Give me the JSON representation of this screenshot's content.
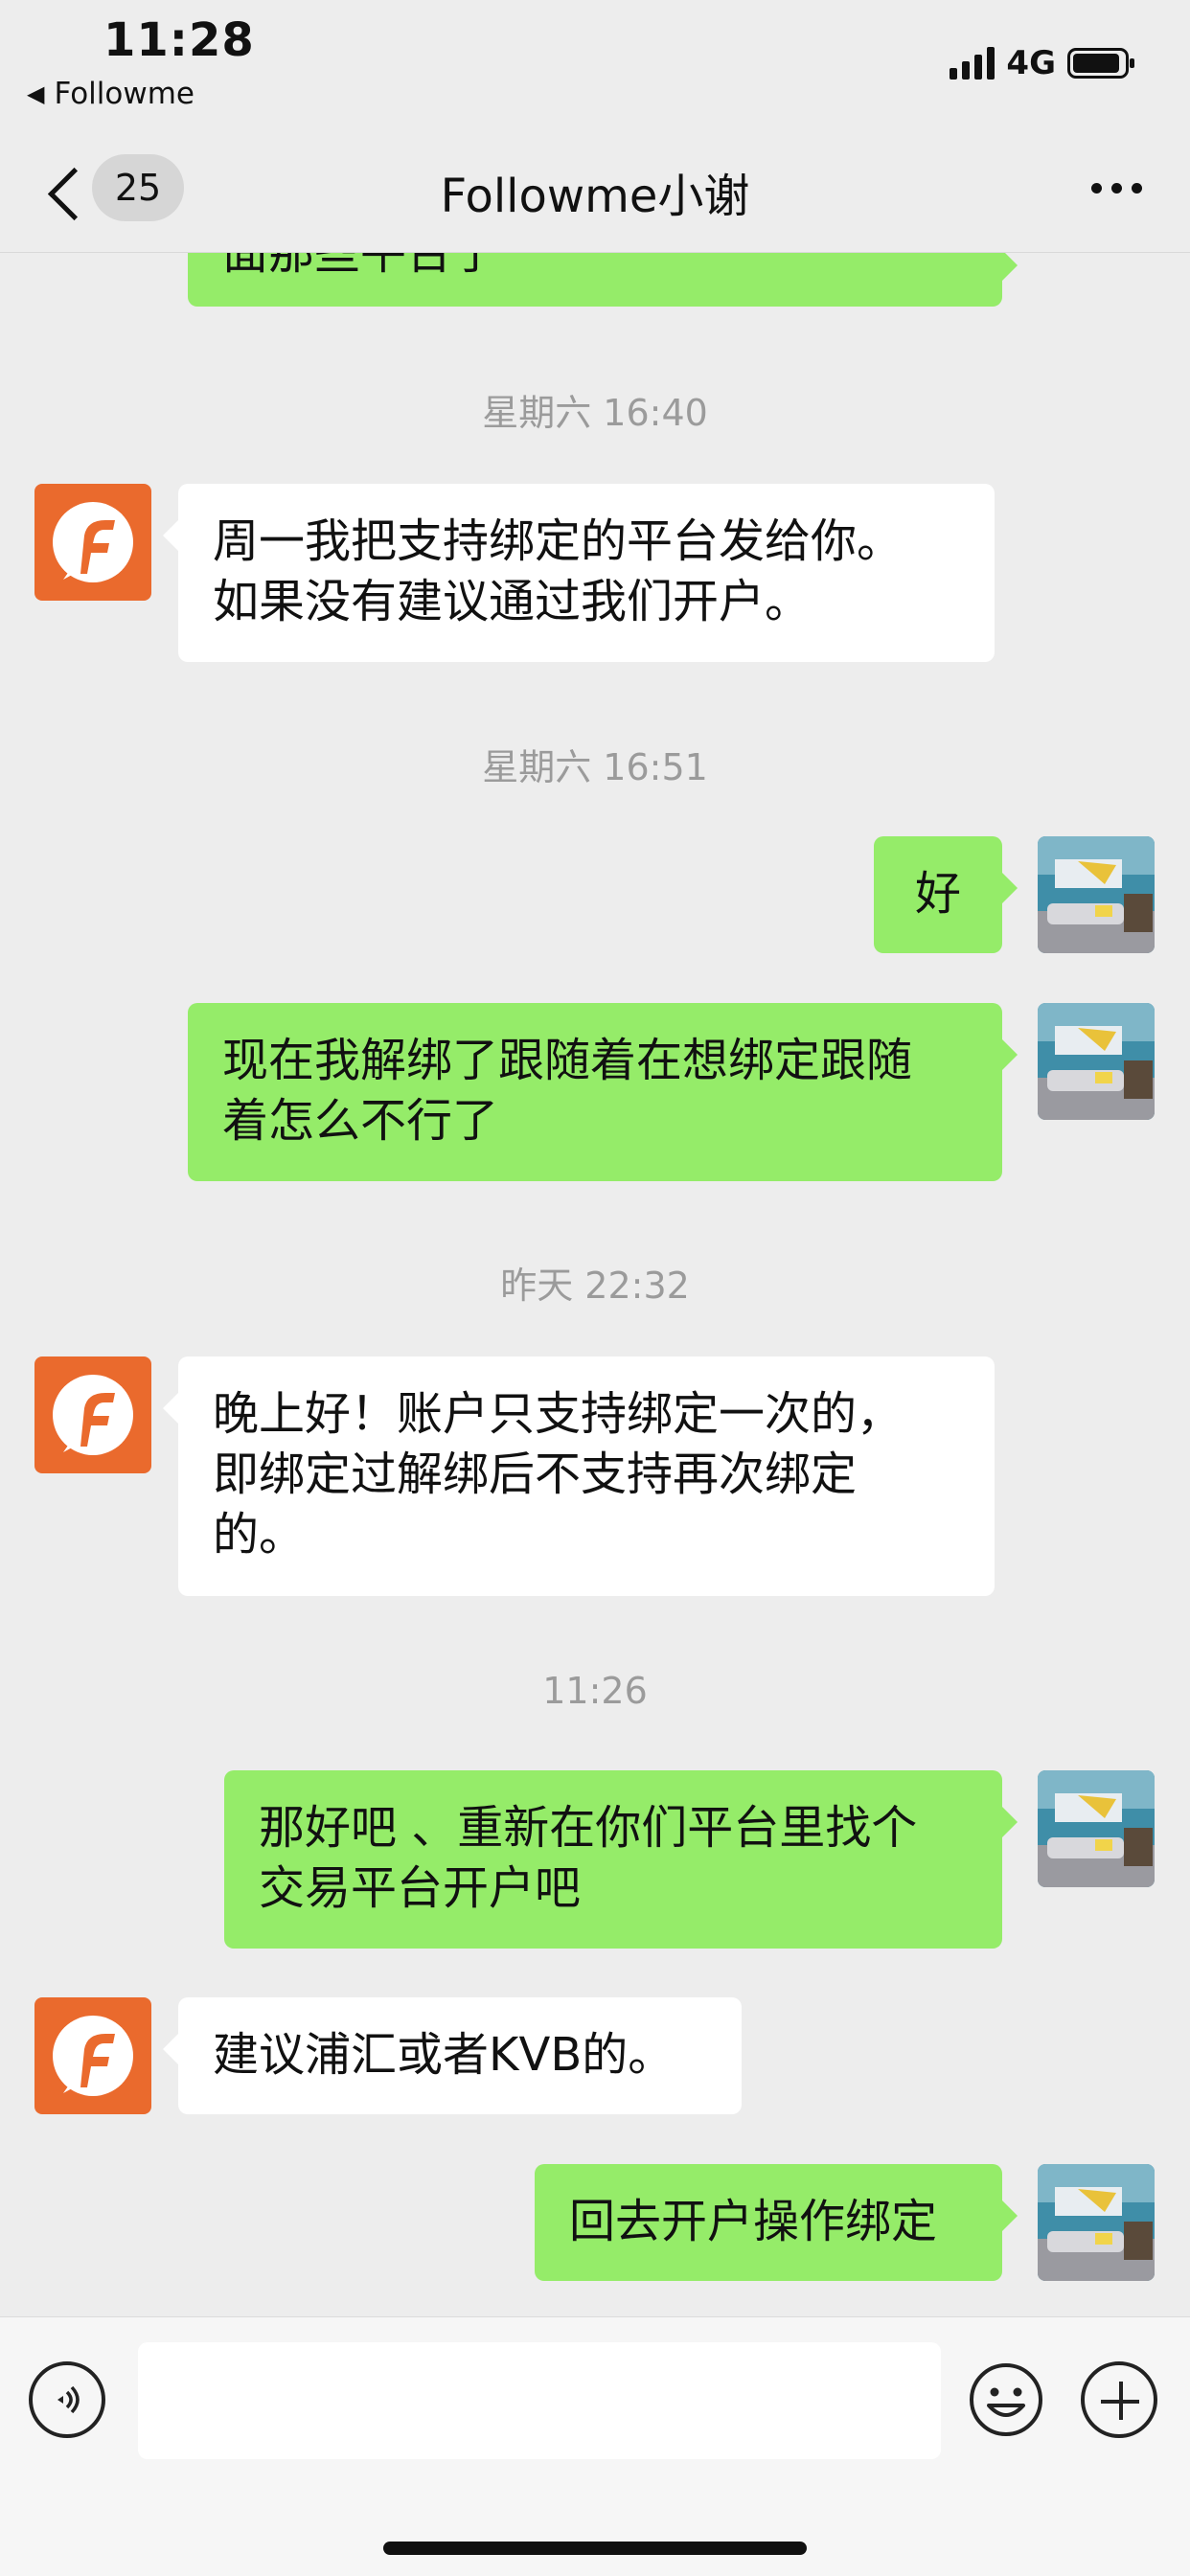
{
  "status_bar": {
    "time": "11:28",
    "back_app": "Followme",
    "network": "4G"
  },
  "nav": {
    "unread_count": "25",
    "title": "Followme小谢"
  },
  "chat": {
    "partial_top_message": "面那些平台了",
    "timestamps": [
      "星期六 16:40",
      "星期六 16:51",
      "昨天 22:32",
      "11:26"
    ],
    "messages": [
      {
        "side": "in",
        "lines": [
          "周一我把支持绑定的平台发给你。",
          "如果没有建议通过我们开户。"
        ]
      },
      {
        "side": "out",
        "lines": [
          "好"
        ]
      },
      {
        "side": "out",
        "lines": [
          "现在我解绑了跟随着在想绑定跟随",
          "着怎么不行了"
        ]
      },
      {
        "side": "in",
        "lines": [
          "晚上好！账户只支持绑定一次的，",
          "即绑定过解绑后不支持再次绑定",
          "的。"
        ]
      },
      {
        "side": "out",
        "lines": [
          "那好吧 、重新在你们平台里找个",
          "交易平台开户吧"
        ]
      },
      {
        "side": "in",
        "lines": [
          "建议浦汇或者KVB的。"
        ]
      },
      {
        "side": "out",
        "lines": [
          "回去开户操作绑定"
        ]
      }
    ]
  },
  "input_bar": {
    "placeholder": ""
  },
  "icons": {
    "back": "chevron-left-icon",
    "more": "more-dots-icon",
    "voice": "voice-icon",
    "emoji": "emoji-icon",
    "plus": "plus-icon"
  },
  "colors": {
    "background": "#ededed",
    "outgoing_bubble": "#95ec69",
    "incoming_bubble": "#ffffff",
    "avatar_brand": "#ea6a2d"
  }
}
